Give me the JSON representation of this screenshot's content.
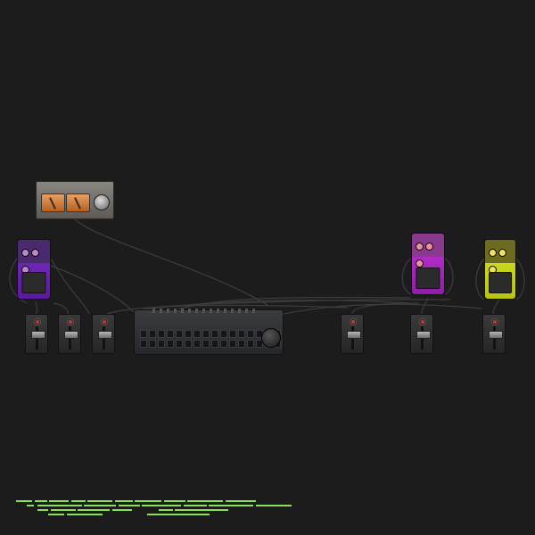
{
  "canvas": {
    "background": "#1c1c1c",
    "cable_color": "#3d3d3d"
  },
  "devices": {
    "vu_meter": {
      "icon": "vu-meter-icon"
    },
    "pedals": [
      {
        "id": "pedal-purple",
        "color": "#7a2fc6"
      },
      {
        "id": "pedal-magenta",
        "color": "#c235d8"
      },
      {
        "id": "pedal-yellow",
        "color": "#d6e422"
      }
    ],
    "sequencer": {
      "rows": 2,
      "steps_per_row": 16
    },
    "channel_strips": 6
  },
  "status": {
    "accent": "#8be05a"
  }
}
